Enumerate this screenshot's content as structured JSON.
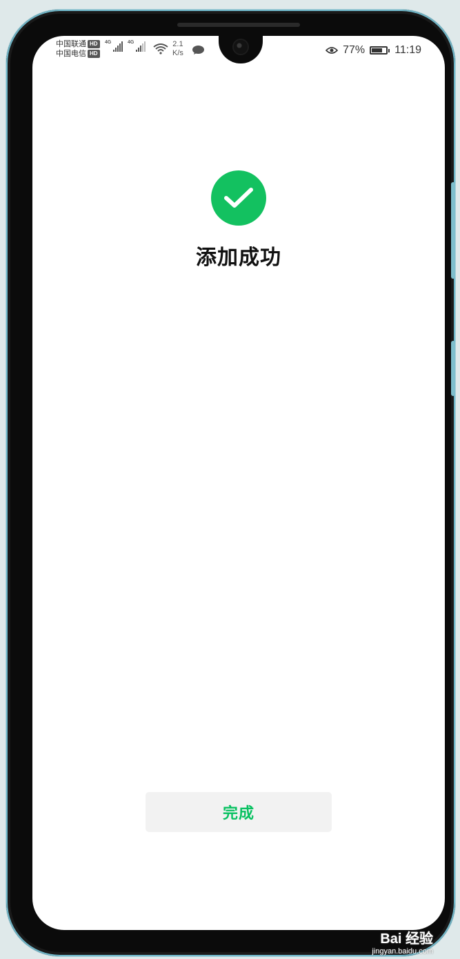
{
  "status_bar": {
    "carrier_1": "中国联通",
    "carrier_2": "中国电信",
    "hd_badge": "HD",
    "network_type": "4G",
    "network_speed_value": "2.1",
    "network_speed_unit": "K/s",
    "eye_comfort_icon": "eye-icon",
    "battery_percent": "77%",
    "battery_level": 0.77,
    "time": "11:19"
  },
  "main": {
    "success_icon": "check-circle-icon",
    "title": "添加成功"
  },
  "footer": {
    "done_label": "完成"
  },
  "watermark": {
    "logo_text": "Bai 经验",
    "url": "jingyan.baidu.com"
  },
  "colors": {
    "accent_green": "#07c160",
    "success_green": "#13c160",
    "button_bg": "#f2f2f2"
  }
}
